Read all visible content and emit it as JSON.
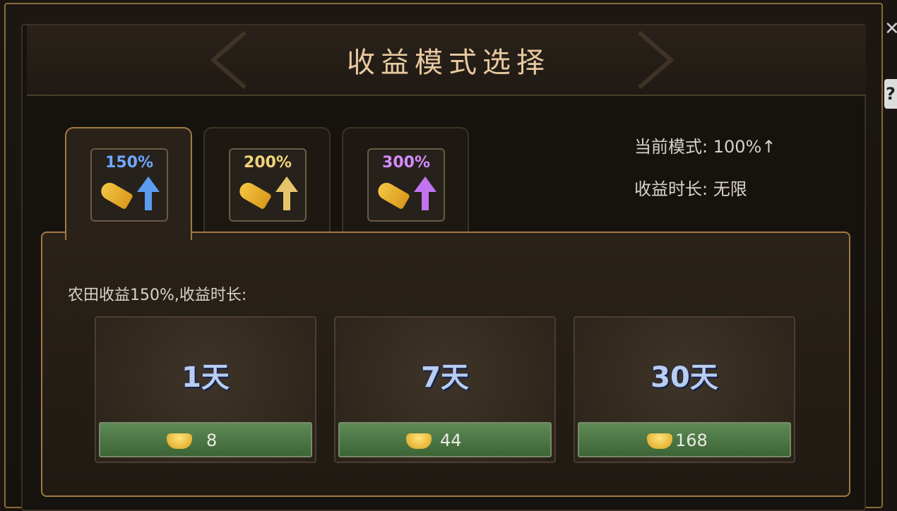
{
  "dialog": {
    "title": "收益模式选择"
  },
  "tabs": [
    {
      "label": "150%",
      "color": "#6fa8ff",
      "arrow_color": "#5b9cf0"
    },
    {
      "label": "200%",
      "color": "#f2d37a",
      "arrow_color": "#e6c46a"
    },
    {
      "label": "300%",
      "color": "#d58bff",
      "arrow_color": "#c274f0"
    }
  ],
  "status": {
    "current_mode": "当前模式: 100%↑",
    "duration": "收益时长: 无限"
  },
  "panel": {
    "description": "农田收益150%,收益时长:",
    "options": [
      {
        "label": "1天",
        "price": "8"
      },
      {
        "label": "7天",
        "price": "44"
      },
      {
        "label": "30天",
        "price": "168"
      }
    ]
  },
  "icons": {
    "close": "close-icon",
    "help": "help-icon",
    "currency": "gold-ingot-icon"
  },
  "controls": {
    "close_glyph": "✕",
    "help_glyph": "?"
  }
}
